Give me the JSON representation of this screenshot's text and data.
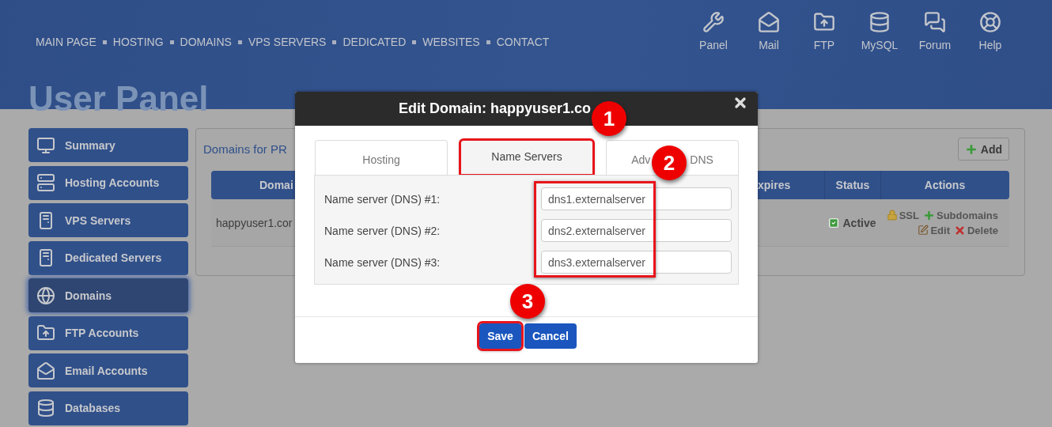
{
  "nav": {
    "links": [
      "MAIN PAGE",
      "HOSTING",
      "DOMAINS",
      "VPS SERVERS",
      "DEDICATED",
      "WEBSITES",
      "CONTACT"
    ],
    "shortcuts": [
      "Panel",
      "Mail",
      "FTP",
      "MySQL",
      "Forum",
      "Help"
    ]
  },
  "page_title": "User Panel",
  "sidebar": {
    "items": [
      {
        "label": "Summary",
        "selected": false
      },
      {
        "label": "Hosting Accounts",
        "selected": false
      },
      {
        "label": "VPS Servers",
        "selected": false
      },
      {
        "label": "Dedicated Servers",
        "selected": false
      },
      {
        "label": "Domains",
        "selected": true
      },
      {
        "label": "FTP Accounts",
        "selected": false
      },
      {
        "label": "Email Accounts",
        "selected": false
      },
      {
        "label": "Databases",
        "selected": false
      }
    ]
  },
  "domains_panel": {
    "title": "Domains for PR",
    "add_button": "Add",
    "table": {
      "columns": [
        "Domai",
        "xpires",
        "Status",
        "Actions"
      ],
      "rows": [
        {
          "domain": "happyuser1.cor",
          "status": "Active",
          "actions": [
            "SSL",
            "Subdomains",
            "Edit",
            "Delete"
          ]
        }
      ]
    }
  },
  "dialog": {
    "title": "Edit Domain: happyuser1.co",
    "tabs": [
      {
        "label": "Hosting",
        "selected": false,
        "highlighted": false
      },
      {
        "label": "Name Servers",
        "selected": true,
        "highlighted": true
      },
      {
        "label_start": "Adv",
        "label_end": "DNS",
        "selected": false,
        "highlighted": false
      }
    ],
    "fields_highlighted": true,
    "fields": [
      {
        "label": "Name server (DNS) #1:",
        "value": "dns1.externalserver"
      },
      {
        "label": "Name server (DNS) #2:",
        "value": "dns2.externalserver"
      },
      {
        "label": "Name server (DNS) #3:",
        "value": "dns3.externalserver"
      }
    ],
    "buttons": [
      {
        "label": "Save",
        "highlighted": true
      },
      {
        "label": "Cancel",
        "highlighted": false
      }
    ],
    "annotations": [
      "1",
      "2",
      "3"
    ]
  }
}
